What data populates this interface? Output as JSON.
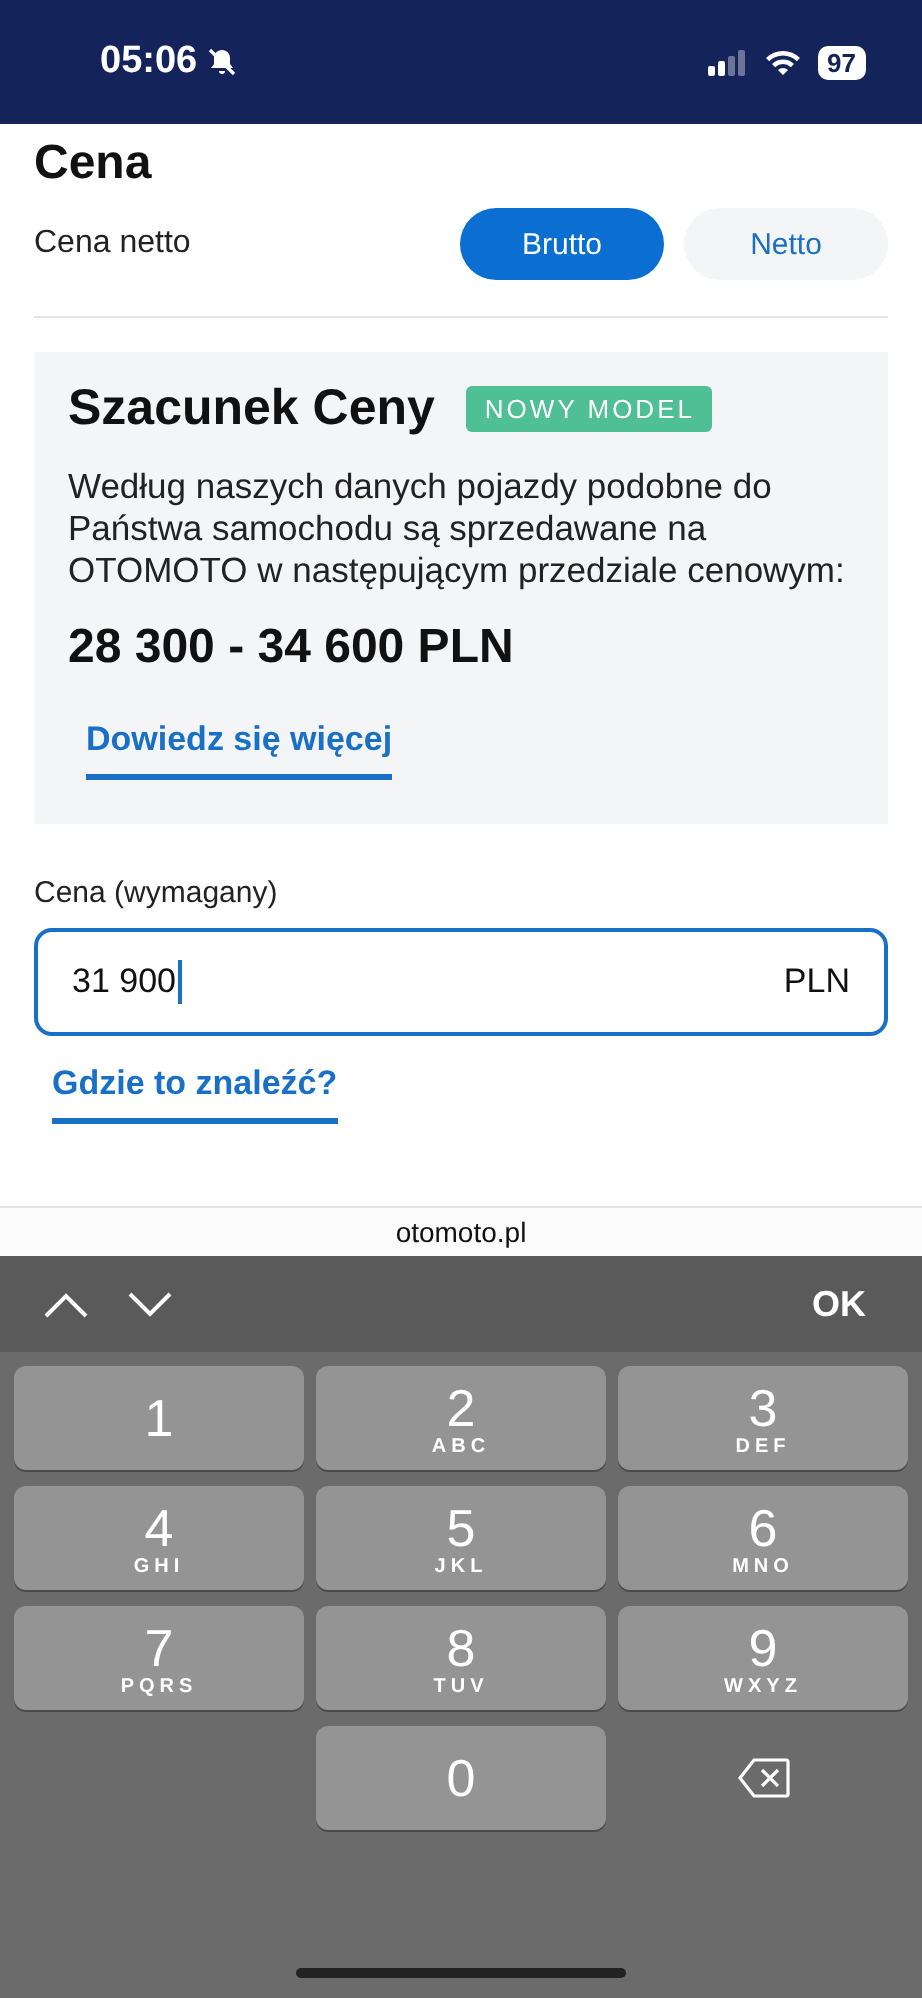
{
  "status_bar": {
    "time": "05:06",
    "silent": true,
    "battery": "97"
  },
  "section": {
    "title": "Cena",
    "toggle_label": "Cena netto",
    "options": [
      {
        "label": "Brutto",
        "selected": true
      },
      {
        "label": "Netto",
        "selected": false
      }
    ]
  },
  "estimate": {
    "title": "Szacunek Ceny",
    "badge": "NOWY MODEL",
    "description": "Według naszych danych pojazdy podobne do Państwa samochodu są sprzedawane na OTOMOTO w następującym przedziale cenowym:",
    "range": "28 300 - 34 600 PLN",
    "link": "Dowiedz się więcej"
  },
  "price_field": {
    "label": "Cena (wymagany)",
    "value": "31 900",
    "unit": "PLN",
    "focused": true
  },
  "help_link": "Gdzie to znaleźć?",
  "url_bar": "otomoto.pl",
  "keyboard_toolbar": {
    "done": "OK"
  },
  "keypad": [
    {
      "kind": "digit",
      "digit": "1"
    },
    {
      "kind": "digit",
      "digit": "2",
      "letters": "ABC"
    },
    {
      "kind": "digit",
      "digit": "3",
      "letters": "DEF"
    },
    {
      "kind": "digit",
      "digit": "4",
      "letters": "GHI"
    },
    {
      "kind": "digit",
      "digit": "5",
      "letters": "JKL"
    },
    {
      "kind": "digit",
      "digit": "6",
      "letters": "MNO"
    },
    {
      "kind": "digit",
      "digit": "7",
      "letters": "PQRS"
    },
    {
      "kind": "digit",
      "digit": "8",
      "letters": "TUV"
    },
    {
      "kind": "digit",
      "digit": "9",
      "letters": "WXYZ"
    },
    {
      "kind": "empty"
    },
    {
      "kind": "digit",
      "digit": "0"
    },
    {
      "kind": "delete"
    }
  ]
}
